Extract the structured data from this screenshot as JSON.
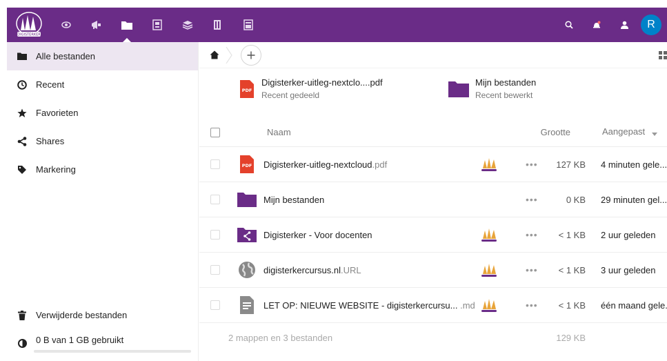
{
  "app": {
    "logo_label": "DIGISTERKER",
    "colors": {
      "primary": "#6a2c87",
      "avatar": "#0082c9",
      "pdf": "#e4412b"
    }
  },
  "header": {
    "apps": [
      {
        "name": "activity-icon"
      },
      {
        "name": "announcements-icon"
      },
      {
        "name": "files-icon",
        "active": true
      },
      {
        "name": "board-icon"
      },
      {
        "name": "stack-icon"
      },
      {
        "name": "notes-icon"
      },
      {
        "name": "forms-icon"
      }
    ],
    "avatar_initial": "R"
  },
  "sidebar": {
    "items": [
      {
        "label": "Alle bestanden",
        "icon": "folder-icon",
        "active": true
      },
      {
        "label": "Recent",
        "icon": "clock-icon"
      },
      {
        "label": "Favorieten",
        "icon": "star-icon"
      },
      {
        "label": "Shares",
        "icon": "share-icon"
      },
      {
        "label": "Markering",
        "icon": "tag-icon"
      }
    ],
    "trash_label": "Verwijderde bestanden",
    "quota_label": "0 B van 1 GB gebruikt",
    "quota_fraction": 0.0
  },
  "recent": [
    {
      "name": "Digisterker-uitleg-nextclo....pdf",
      "sub": "Recent gedeeld",
      "icon": "pdf-icon"
    },
    {
      "name": "Mijn bestanden",
      "sub": "Recent bewerkt",
      "icon": "folder-icon"
    }
  ],
  "table": {
    "headers": {
      "name": "Naam",
      "size": "Grootte",
      "modified": "Aangepast"
    },
    "rows": [
      {
        "base": "Digisterker-uitleg-nextcloud",
        "ext": ".pdf",
        "icon": "pdf",
        "shared": true,
        "size": "127 KB",
        "modified": "4 minuten gele..."
      },
      {
        "base": "Mijn bestanden",
        "ext": "",
        "icon": "folder",
        "shared": false,
        "size": "0 KB",
        "modified": "29 minuten gel..."
      },
      {
        "base": "Digisterker - Voor docenten",
        "ext": "",
        "icon": "shared-folder",
        "shared": true,
        "size": "< 1 KB",
        "modified": "2 uur geleden"
      },
      {
        "base": "digisterkercursus.nl",
        "ext": ".URL",
        "icon": "globe",
        "shared": true,
        "size": "< 1 KB",
        "modified": "3 uur geleden"
      },
      {
        "base": "LET OP: NIEUWE WEBSITE - digisterkercursu... ",
        "ext": ".md",
        "icon": "text",
        "shared": true,
        "size": "< 1 KB",
        "modified": "één maand gele..."
      }
    ],
    "summary": {
      "count": "2 mappen en 3 bestanden",
      "total": "129 KB"
    }
  }
}
